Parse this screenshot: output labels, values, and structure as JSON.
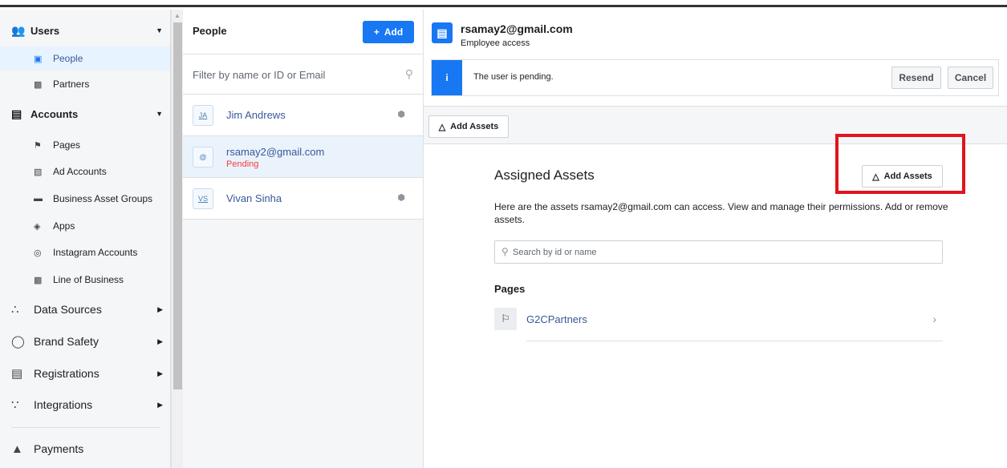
{
  "sidebar": {
    "users": {
      "label": "Users",
      "icon": "users-icon"
    },
    "people": {
      "label": "People",
      "icon": "person-badge-icon"
    },
    "partners": {
      "label": "Partners",
      "icon": "briefcase-icon"
    },
    "accounts": {
      "label": "Accounts",
      "icon": "folder-icon"
    },
    "pages": {
      "label": "Pages",
      "icon": "flag-icon"
    },
    "ad_accounts": {
      "label": "Ad Accounts",
      "icon": "ad-account-icon"
    },
    "business_asset_groups": {
      "label": "Business Asset Groups",
      "icon": "folder-icon"
    },
    "apps": {
      "label": "Apps",
      "icon": "cube-icon"
    },
    "instagram_accounts": {
      "label": "Instagram Accounts",
      "icon": "instagram-icon"
    },
    "line_of_business": {
      "label": "Line of Business",
      "icon": "briefcase-icon"
    },
    "data_sources": {
      "label": "Data Sources",
      "icon": "data-sources-icon"
    },
    "brand_safety": {
      "label": "Brand Safety",
      "icon": "shield-icon"
    },
    "registrations": {
      "label": "Registrations",
      "icon": "clipboard-icon"
    },
    "integrations": {
      "label": "Integrations",
      "icon": "integrations-icon"
    },
    "payments": {
      "label": "Payments",
      "icon": "bank-icon"
    }
  },
  "people_panel": {
    "title": "People",
    "add_label": "Add",
    "filter_placeholder": "Filter by name or ID or Email",
    "people": [
      {
        "initials": "JA",
        "name": "Jim Andrews",
        "status": ""
      },
      {
        "initials": "@",
        "name": "rsamay2@gmail.com",
        "status": "Pending"
      },
      {
        "initials": "VS",
        "name": "Vivan Sinha",
        "status": ""
      }
    ]
  },
  "detail": {
    "email": "rsamay2@gmail.com",
    "access": "Employee access",
    "notice": "The user is pending.",
    "resend_label": "Resend",
    "cancel_label": "Cancel",
    "add_assets_label": "Add Assets",
    "assigned_title": "Assigned Assets",
    "assigned_add_label": "Add Assets",
    "description": "Here are the assets rsamay2@gmail.com can access. View and manage their permissions. Add or remove assets.",
    "search_placeholder": "Search by id or name",
    "pages_heading": "Pages",
    "pages": [
      {
        "name": "G2CPartners"
      }
    ]
  },
  "colors": {
    "accent": "#1877f2",
    "highlight": "#e2141c",
    "pending": "#fa383e"
  }
}
